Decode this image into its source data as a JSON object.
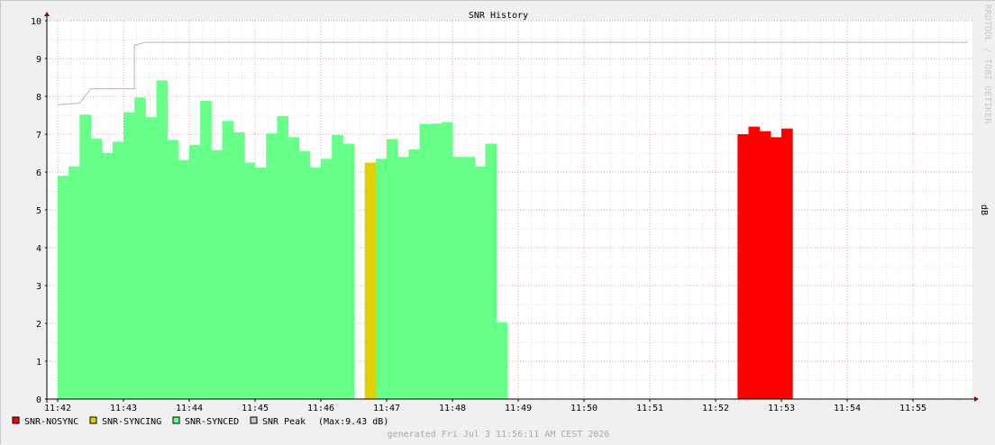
{
  "chart_data": {
    "type": "bar",
    "title": "SNR History",
    "ylabel": "dB",
    "side_label": "RRDTOOL / TOBI OETIKER",
    "ylim": [
      0,
      10
    ],
    "y_ticks": [
      "0",
      "1",
      "2",
      "3",
      "4",
      "5",
      "6",
      "7",
      "8",
      "9",
      "10"
    ],
    "x_ticks": [
      "11:42",
      "11:43",
      "11:44",
      "11:45",
      "11:46",
      "11:47",
      "11:48",
      "11:49",
      "11:50",
      "11:51",
      "11:52",
      "11:53",
      "11:54",
      "11:55"
    ],
    "bucket_seconds": 10,
    "start_time": "11:42:00",
    "series": [
      {
        "name": "SNR-NOSYNC",
        "color": "#ff0000",
        "points": [
          {
            "t": "11:52:20",
            "v": 7.0
          },
          {
            "t": "11:52:30",
            "v": 7.2
          },
          {
            "t": "11:52:40",
            "v": 7.08
          },
          {
            "t": "11:52:50",
            "v": 6.92
          },
          {
            "t": "11:53:00",
            "v": 7.15
          }
        ]
      },
      {
        "name": "SNR-SYNCING",
        "color": "#e0d000",
        "points": [
          {
            "t": "11:46:40",
            "v": 6.25
          }
        ]
      },
      {
        "name": "SNR-SYNCED",
        "color": "#66ff88",
        "points": [
          {
            "t": "11:42:00",
            "v": 5.9
          },
          {
            "t": "11:42:10",
            "v": 6.15
          },
          {
            "t": "11:42:20",
            "v": 7.52
          },
          {
            "t": "11:42:30",
            "v": 6.88
          },
          {
            "t": "11:42:40",
            "v": 6.5
          },
          {
            "t": "11:42:50",
            "v": 6.8
          },
          {
            "t": "11:43:00",
            "v": 7.58
          },
          {
            "t": "11:43:10",
            "v": 7.97
          },
          {
            "t": "11:43:20",
            "v": 7.45
          },
          {
            "t": "11:43:30",
            "v": 8.42
          },
          {
            "t": "11:43:40",
            "v": 6.85
          },
          {
            "t": "11:43:50",
            "v": 6.32
          },
          {
            "t": "11:44:00",
            "v": 6.72
          },
          {
            "t": "11:44:10",
            "v": 7.88
          },
          {
            "t": "11:44:20",
            "v": 6.58
          },
          {
            "t": "11:44:30",
            "v": 7.35
          },
          {
            "t": "11:44:40",
            "v": 7.05
          },
          {
            "t": "11:44:50",
            "v": 6.25
          },
          {
            "t": "11:45:00",
            "v": 6.12
          },
          {
            "t": "11:45:10",
            "v": 7.02
          },
          {
            "t": "11:45:20",
            "v": 7.48
          },
          {
            "t": "11:45:30",
            "v": 6.92
          },
          {
            "t": "11:45:40",
            "v": 6.55
          },
          {
            "t": "11:45:50",
            "v": 6.12
          },
          {
            "t": "11:46:00",
            "v": 6.35
          },
          {
            "t": "11:46:10",
            "v": 6.98
          },
          {
            "t": "11:46:20",
            "v": 6.75
          },
          {
            "t": "11:46:50",
            "v": 6.35
          },
          {
            "t": "11:47:00",
            "v": 6.87
          },
          {
            "t": "11:47:10",
            "v": 6.4
          },
          {
            "t": "11:47:20",
            "v": 6.6
          },
          {
            "t": "11:47:30",
            "v": 7.27
          },
          {
            "t": "11:47:40",
            "v": 7.28
          },
          {
            "t": "11:47:50",
            "v": 7.32
          },
          {
            "t": "11:48:00",
            "v": 6.4
          },
          {
            "t": "11:48:10",
            "v": 6.4
          },
          {
            "t": "11:48:20",
            "v": 6.15
          },
          {
            "t": "11:48:30",
            "v": 6.75
          },
          {
            "t": "11:48:40",
            "v": 2.03
          }
        ]
      },
      {
        "name": "SNR Peak",
        "color": "#c8c8c8",
        "line": [
          {
            "t": "11:42:00",
            "v": 7.78
          },
          {
            "t": "11:42:20",
            "v": 7.82
          },
          {
            "t": "11:42:30",
            "v": 8.2
          },
          {
            "t": "11:43:10",
            "v": 8.2
          },
          {
            "t": "11:43:10",
            "v": 9.35
          },
          {
            "t": "11:43:20",
            "v": 9.43
          },
          {
            "t": "11:55:50",
            "v": 9.43
          }
        ]
      }
    ],
    "legend": [
      {
        "label": "SNR-NOSYNC",
        "color": "#ff0000"
      },
      {
        "label": "SNR-SYNCING",
        "color": "#e0d000"
      },
      {
        "label": "SNR-SYNCED",
        "color": "#66ff88"
      },
      {
        "label": "SNR Peak",
        "color": "#c8c8c8"
      }
    ],
    "legend_note": "(Max:9.43 dB)",
    "footer": "generated Fri Jul  3 11:56:11 AM CEST 2026",
    "grid": true
  }
}
